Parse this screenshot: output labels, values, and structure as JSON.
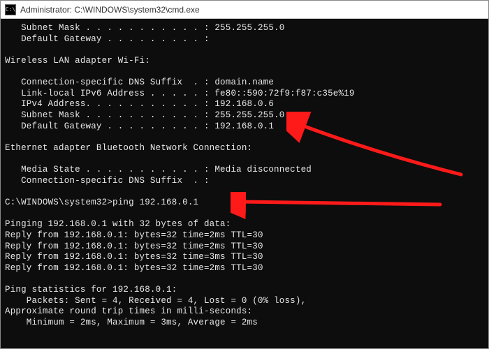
{
  "titlebar": {
    "title": "Administrator: C:\\WINDOWS\\system32\\cmd.exe",
    "icon_glyph": "C:\\"
  },
  "terminal": {
    "lines": [
      "   Subnet Mask . . . . . . . . . . . : 255.255.255.0",
      "   Default Gateway . . . . . . . . . :",
      "",
      "Wireless LAN adapter Wi-Fi:",
      "",
      "   Connection-specific DNS Suffix  . : domain.name",
      "   Link-local IPv6 Address . . . . . : fe80::590:72f9:f87:c35e%19",
      "   IPv4 Address. . . . . . . . . . . : 192.168.0.6",
      "   Subnet Mask . . . . . . . . . . . : 255.255.255.0",
      "   Default Gateway . . . . . . . . . : 192.168.0.1",
      "",
      "Ethernet adapter Bluetooth Network Connection:",
      "",
      "   Media State . . . . . . . . . . . : Media disconnected",
      "   Connection-specific DNS Suffix  . :",
      "",
      "C:\\WINDOWS\\system32>ping 192.168.0.1",
      "",
      "Pinging 192.168.0.1 with 32 bytes of data:",
      "Reply from 192.168.0.1: bytes=32 time=2ms TTL=30",
      "Reply from 192.168.0.1: bytes=32 time=2ms TTL=30",
      "Reply from 192.168.0.1: bytes=32 time=3ms TTL=30",
      "Reply from 192.168.0.1: bytes=32 time=2ms TTL=30",
      "",
      "Ping statistics for 192.168.0.1:",
      "    Packets: Sent = 4, Received = 4, Lost = 0 (0% loss),",
      "Approximate round trip times in milli-seconds:",
      "    Minimum = 2ms, Maximum = 3ms, Average = 2ms",
      ""
    ]
  },
  "annotations": {
    "arrow_color": "#ff1a1a"
  },
  "watermark": ""
}
